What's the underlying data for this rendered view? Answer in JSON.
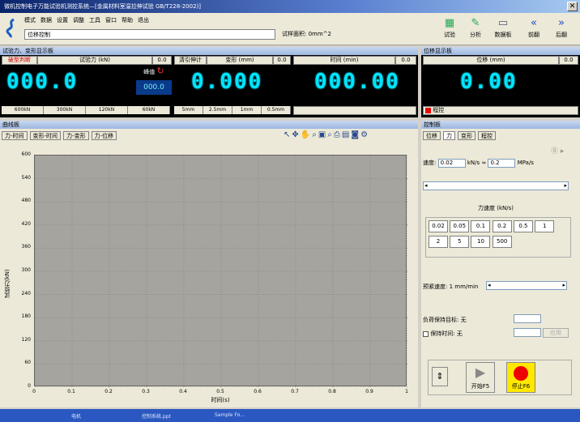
{
  "window": {
    "title": "微机控制电子万能试验机测控系统—[金属材料室温拉伸试验 GB/T228-2002)]"
  },
  "menu": [
    "模式",
    "数据",
    "设置",
    "调整",
    "工具",
    "窗口",
    "帮助",
    "退出"
  ],
  "control_mode": "位移控制",
  "sample_area": "试样面积: 0mm^2",
  "toolbar_buttons": [
    {
      "label": "试验",
      "icon": "test-icon"
    },
    {
      "label": "分析",
      "icon": "analyze-icon"
    },
    {
      "label": "数据板",
      "icon": "databoard-icon"
    },
    {
      "label": "前翻",
      "icon": "prev-page-icon"
    },
    {
      "label": "后翻",
      "icon": "next-page-icon"
    }
  ],
  "left_panel": {
    "header": "试验力、变形显示板",
    "force": {
      "mode_label": "破型判断",
      "title": "试验力 (kN)",
      "unit_value": "0.0",
      "peak_label": "峰值",
      "value": "000.0",
      "peak_value": "000.0",
      "ranges": [
        "600kN",
        "300kN",
        "120kN",
        "60kN"
      ]
    },
    "extension": {
      "extensometer_label": "清引伸计",
      "title": "变形 (mm)",
      "unit_value": "0.0",
      "value": "0.000",
      "ranges": [
        "5mm",
        "2.5mm",
        "1mm",
        "0.5mm"
      ]
    },
    "time": {
      "title": "时间 (min)",
      "unit_value": "0.0",
      "value": "000.00"
    }
  },
  "displacement_panel": {
    "header": "位移显示板",
    "title": "位移 (mm)",
    "unit_value": "0.0",
    "value": "0.00",
    "program_label": "程控"
  },
  "curve_panel": {
    "header": "曲线板",
    "tabs": [
      "力-时间",
      "变形-时间",
      "力-变形",
      "力-位移"
    ],
    "tool_icons": [
      "pointer-icon",
      "move-icon",
      "pan-icon",
      "zoom-icon",
      "fit-icon",
      "zoom-out-icon",
      "print-icon",
      "export-icon",
      "save-icon",
      "settings-icon"
    ]
  },
  "chart_data": {
    "type": "line",
    "xlabel": "时间(s)",
    "ylabel": "试验力(kN)",
    "x_ticks": [
      "0",
      "0.1",
      "0.2",
      "0.3",
      "0.4",
      "0.5",
      "0.6",
      "0.7",
      "0.8",
      "0.9",
      "1"
    ],
    "y_ticks": [
      "0",
      "60",
      "120",
      "180",
      "240",
      "300",
      "360",
      "420",
      "480",
      "540",
      "600"
    ],
    "xlim": [
      0,
      1
    ],
    "ylim": [
      0,
      600
    ],
    "grid": true,
    "series": []
  },
  "control_panel": {
    "header": "控制板",
    "tabs": [
      "位移",
      "力",
      "变形",
      "程控"
    ],
    "speed_label": "速度:",
    "speed_value": "0.02",
    "speed_unit": "kN/s",
    "approx": "≈",
    "speed_value2": "0.2",
    "speed_unit2": "MPa/s",
    "rate_title": "力速度 (kN/s)",
    "rates": [
      "0.02",
      "0.05",
      "0.1",
      "0.2",
      "0.5",
      "1",
      "2",
      "5",
      "10",
      "500"
    ],
    "preset_label": "预紧速度: 1 mm/min",
    "hold_target": "负荷保持目标: 无",
    "hold_time": "保持时间: 无",
    "apply_label": "应用",
    "start_label": "开始F5",
    "stop_label": "停止F6"
  },
  "taskbar": [
    "电机",
    "控制系统.ppt",
    "Sample Fo..."
  ]
}
